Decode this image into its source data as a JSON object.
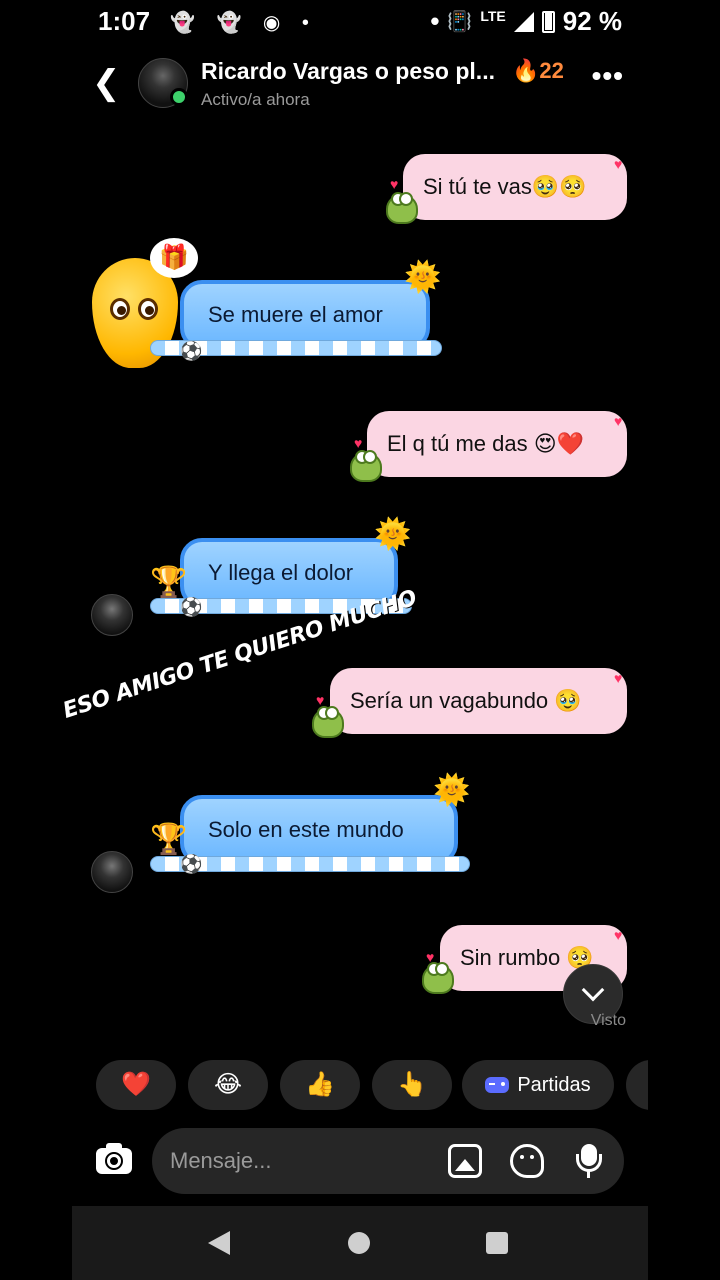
{
  "status_bar": {
    "time": "1:07",
    "notification_icons": "👻 👻 ◉ •",
    "network": "LTE",
    "battery": "92 %"
  },
  "header": {
    "contact_name": "Ricardo Vargas o peso pl...",
    "streak": "🔥22",
    "status": "Activo/a ahora"
  },
  "messages": [
    {
      "side": "right",
      "text": "Si tú te vas🥹🥺"
    },
    {
      "side": "left",
      "text": "Se muere el amor"
    },
    {
      "side": "right",
      "text": "El q tú me das 😍❤️"
    },
    {
      "side": "left",
      "text": "Y llega el dolor"
    },
    {
      "side": "right",
      "text": "Sería un vagabundo 🥹"
    },
    {
      "side": "left",
      "text": "Solo en este mundo"
    },
    {
      "side": "right",
      "text": "Sin rumbo 🥺"
    }
  ],
  "overlay_caption": "ESO AMIGO TE QUIERO MUCHO",
  "seen_label": "Visto",
  "quick_replies": [
    {
      "label": "❤️"
    },
    {
      "label": "😂"
    },
    {
      "label": "👍"
    },
    {
      "label": "👆"
    },
    {
      "label": "Partidas"
    }
  ],
  "composer": {
    "placeholder": "Mensaje..."
  },
  "colors": {
    "background": "#000000",
    "right_bubble": "#fbd6e3",
    "left_bubble": "#8cc8ff",
    "online": "#3dd16b"
  }
}
